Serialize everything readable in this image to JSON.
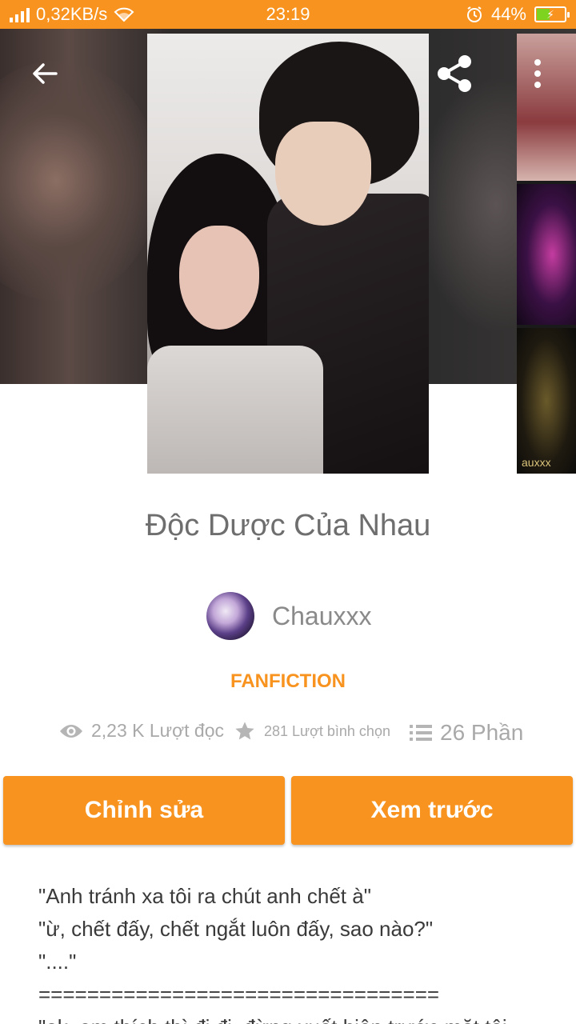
{
  "status_bar": {
    "network_speed": "0,32KB/s",
    "time": "23:19",
    "battery_percent": "44%",
    "battery_level": 0.44
  },
  "story": {
    "title": "Độc Dược Của Nhau",
    "author": "Chauxxx",
    "category": "FANFICTION",
    "reads": "2,23 K Lượt đọc",
    "votes": "281 Lượt bình chọn",
    "parts": "26 Phần",
    "thumb_caption": "auxxx"
  },
  "actions": {
    "edit_label": "Chỉnh sửa",
    "preview_label": "Xem trước"
  },
  "description": [
    "\"Anh tránh xa tôi ra chút anh chết à\"",
    "\"ừ, chết đấy, chết ngắt luôn đấy, sao nào?\"",
    "\"....\"",
    "=================================",
    "\"ok, em thích thì đi đi, đừng xuất hiện trước mặt tôi"
  ],
  "colors": {
    "accent": "#f7931e",
    "title_text": "#6e6e6e",
    "muted_text": "#a9a9a9"
  },
  "icons": {
    "back": "arrow-left-icon",
    "share": "share-icon",
    "more": "more-vertical-icon",
    "reads": "eye-icon",
    "votes": "star-icon",
    "parts": "list-icon"
  }
}
